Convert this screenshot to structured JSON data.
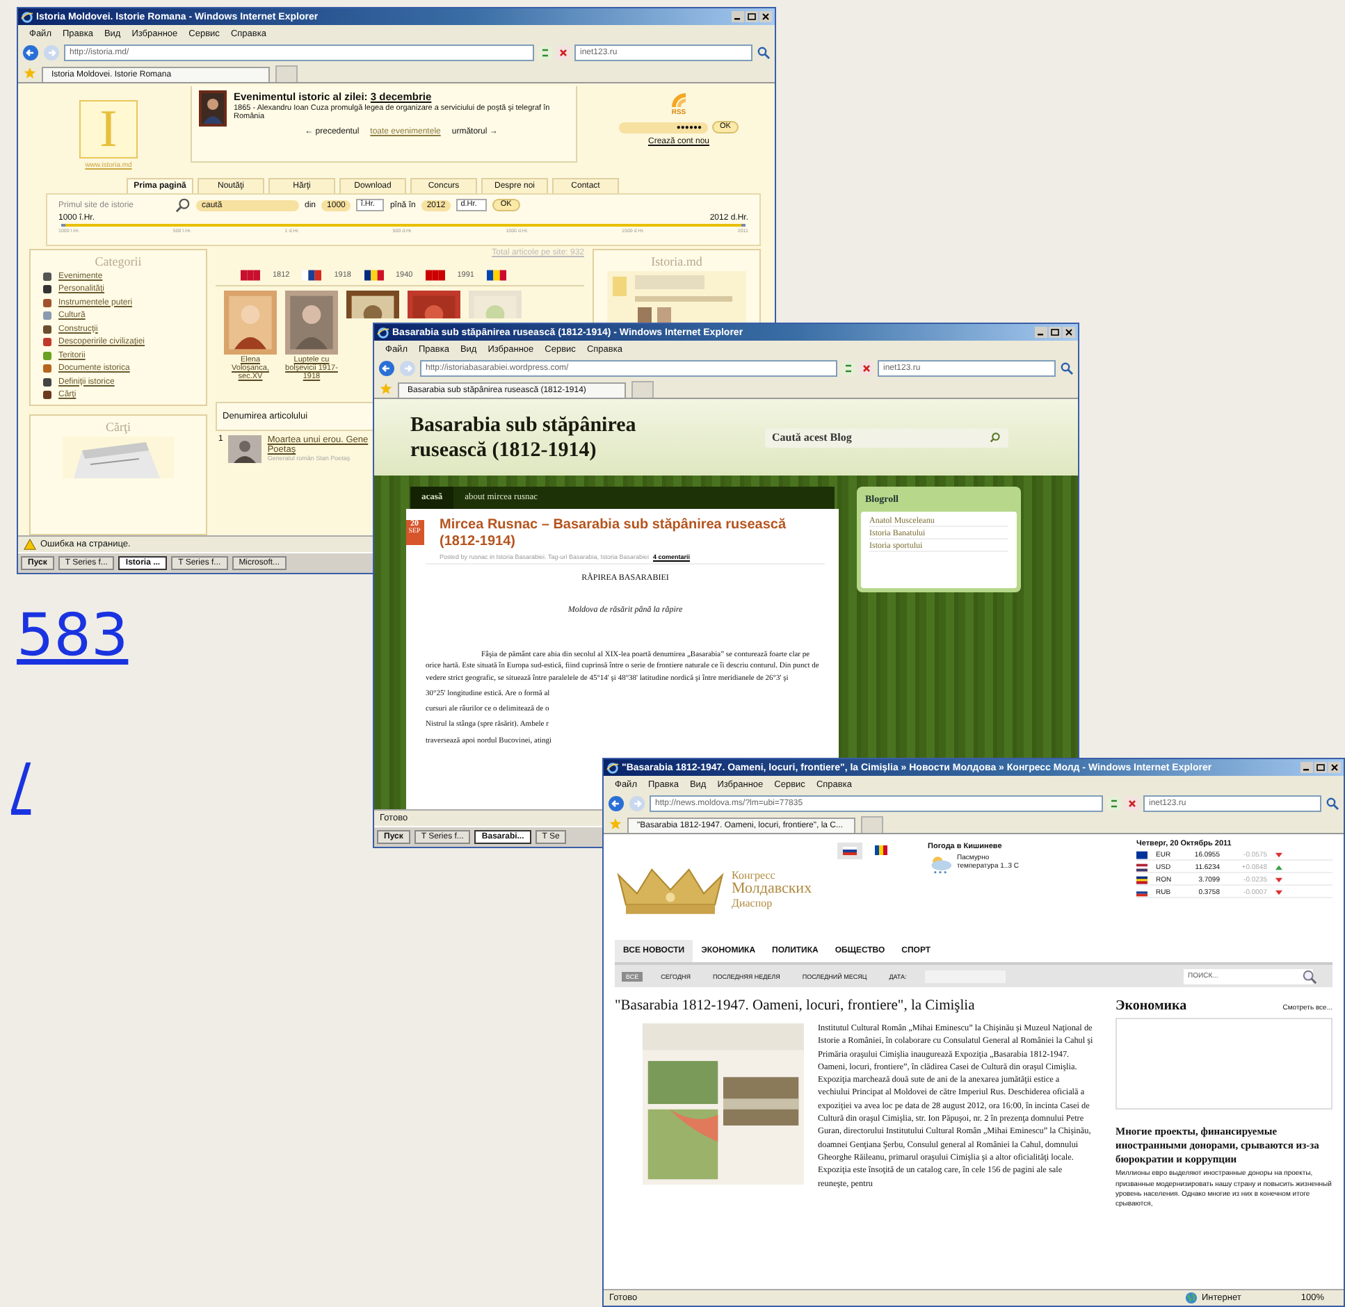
{
  "background_links": [
    "583",
    "/"
  ],
  "windows": [
    {
      "kind": "istoria",
      "title": "Istoria Moldovei. Istorie Romana - Windows Internet Explorer",
      "menu": [
        "Файл",
        "Правка",
        "Вид",
        "Избранное",
        "Сервис",
        "Справка"
      ],
      "address": "http://istoria.md/",
      "search": "inet123.ru",
      "tab": "Istoria Moldovei. Istorie Romana",
      "status": "Ошибка на странице.",
      "status_warning": true,
      "taskbar": [
        {
          "kind": "start",
          "label": "Пуск",
          "selected": false
        },
        {
          "kind": "app",
          "label": "T Series f...",
          "selected": false
        },
        {
          "kind": "ie",
          "label": "Istoria ...",
          "selected": true
        },
        {
          "kind": "app",
          "label": "T Series f...",
          "selected": false
        },
        {
          "kind": "doc",
          "label": "Microsoft...",
          "selected": false
        }
      ]
    },
    {
      "kind": "blog",
      "title": "Basarabia sub stăpânirea rusească (1812-1914) - Windows Internet Explorer",
      "menu": [
        "Файл",
        "Правка",
        "Вид",
        "Избранное",
        "Сервис",
        "Справка"
      ],
      "address": "http://istoriabasarabiei.wordpress.com/",
      "search": "inet123.ru",
      "tab": "Basarabia sub stăpânirea rusească (1812-1914)",
      "status": "Готово",
      "status_warning": false,
      "taskbar": [
        {
          "kind": "start",
          "label": "Пуск",
          "selected": false
        },
        {
          "kind": "app",
          "label": "T Series f...",
          "selected": false
        },
        {
          "kind": "ie",
          "label": "Basarabi...",
          "selected": true
        },
        {
          "kind": "app",
          "label": "T Se",
          "selected": false
        }
      ]
    },
    {
      "kind": "news",
      "title": "\"Basarabia 1812-1947. Oameni, locuri, frontiere\", la Cimişlia » Новости Молдова » Конгресс Молд - Windows Internet Explorer",
      "menu": [
        "Файл",
        "Правка",
        "Вид",
        "Избранное",
        "Сервис",
        "Справка"
      ],
      "address": "http://news.moldova.ms/?lm=ubi=77835",
      "search": "inet123.ru",
      "tab": "\"Basarabia 1812-1947. Oameni, locuri, frontiere\", la C...",
      "status": "Готово",
      "status_warning": false,
      "zone": "Интернет",
      "zoom": "100%"
    }
  ],
  "istoria": {
    "logo_letter": "I",
    "logo_caption": "www.istoria.md",
    "event": {
      "heading": "Evenimentul istoric al zilei:",
      "date": "3 decembrie",
      "text": "1865 - Alexandru Ioan Cuza promulgă legea de organizare a serviciului de poştă şi telegraf în România",
      "prev": "← precedentul",
      "all": "toate evenimentele",
      "next": "următorul →"
    },
    "rss": "RSS",
    "password": "●●●●●●",
    "login_button": "OK",
    "register_link": "Crează cont nou",
    "tabs": [
      {
        "label": "Prima pagină",
        "selected": true
      },
      {
        "label": "Noutăţi",
        "selected": false
      },
      {
        "label": "Hărţi",
        "selected": false
      },
      {
        "label": "Download",
        "selected": false
      },
      {
        "label": "Concurs",
        "selected": false
      },
      {
        "label": "Despre noi",
        "selected": false
      },
      {
        "label": "Contact",
        "selected": false
      }
    ],
    "search": {
      "tagline": "Primul site de istorie",
      "query": "caută",
      "from_label": "din",
      "from_year": "1000",
      "from_era": "î.Hr.",
      "to_label": "pînă în",
      "to_year": "2012",
      "to_era": "d.Hr.",
      "button": "OK"
    },
    "timeline": {
      "start": "1000 î.Hr.",
      "end": "2012 d.Hr.",
      "level": 1,
      "ticks": [
        "1000 î.Hr.",
        "500 î.Hr.",
        "1 d.Hr.",
        "500 d.Hr.",
        "1000 d.Hr.",
        "1500 d.Hr.",
        "2011"
      ]
    },
    "total": "Total articole pe site: 932",
    "categories_title": "Categorii",
    "categories": [
      "Evenimente",
      "Personalităţi",
      "Instrumentele puteri",
      "Cultură",
      "Construcţii",
      "Descoperirile civilizaţiei",
      "Teritorii",
      "Documente istorica",
      "Definiţii istorice",
      "Cărţi"
    ],
    "books_title": "Cărţi",
    "years": [
      "1812",
      "1918",
      "1940",
      "1991"
    ],
    "gallery": [
      {
        "kind": "full",
        "caption": "Elena Voloşanca, sec.XV"
      },
      {
        "kind": "full",
        "caption": "Luptele cu bolşevicii 1917-1918"
      },
      {
        "kind": "cropped"
      },
      {
        "kind": "cropped"
      },
      {
        "kind": "cropped"
      }
    ],
    "articles_header": "Denumirea articolului",
    "articles": [
      {
        "number": "1",
        "title": "Moartea unui erou. Gene",
        "title_cont": "Poetaş",
        "summary": "Generalul român Stan Poetaş"
      }
    ],
    "side_title": "Istoria.md"
  },
  "blog": {
    "title": "Basarabia sub stăpânirea rusească (1812-1914)",
    "search_placeholder": "Caută acest Blog",
    "nav": [
      {
        "label": "acasă",
        "selected": true
      },
      {
        "label": "about mircea rusnac",
        "selected": false
      }
    ],
    "day": "20",
    "month": "SEP",
    "post_title": "Mircea Rusnac – Basarabia sub stăpânirea rusească (1812-1914)",
    "meta": "Posted by rusnac in Istoria Basarabiei. Tag-uri Basarabia, Istoria Basarabiei",
    "comments": "4 comentarii",
    "heading": "RĂPIREA BASARABIEI",
    "subheading": "Moldova de răsărit până la răpire",
    "paragraph": "Fâşia de pământ care abia din secolul al XIX-lea poartă denumirea „Basarabia” se conturează foarte clar pe orice hartă. Este situată în Europa sud-estică, fiind cuprinsă între o serie de frontiere naturale ce îi descriu conturul. Din punct de vedere strict geografic, se situează între paralelele de 45°14' şi 48°38' latitudine nordică şi între meridianele de 26°3' şi",
    "paragraph_lines": [
      "30°25' longitudine estică. Are o formă al",
      "cursuri ale râurilor ce o delimitează de o",
      "Nistrul la stânga (spre răsărit). Ambele r",
      "traversează apoi nordul Bucovinei, atingi"
    ],
    "blogroll_title": "Blogroll",
    "blogroll": [
      "Anatol Musceleanu",
      "Istoria Banatului",
      "Istoria sportului"
    ]
  },
  "news": {
    "languages": [
      {
        "kind": "ru",
        "selected": true
      },
      {
        "kind": "md",
        "selected": false
      }
    ],
    "logo_lines": [
      "Конгресс",
      "Молдавских",
      "Диаспор"
    ],
    "weather_title": "Погода в Кишиневе",
    "weather_state": "Пасмурно",
    "weather_temp": "температура 1..3 C",
    "date": "Четверг, 20 Октябрь 2011",
    "rates": [
      {
        "currency": "EUR",
        "rate": "16.0955",
        "change": "-0.0575",
        "rising": false
      },
      {
        "currency": "USD",
        "rate": "11.6234",
        "change": "+0.0848",
        "rising": true
      },
      {
        "currency": "RON",
        "rate": "3.7099",
        "change": "-0.0235",
        "rising": false
      },
      {
        "currency": "RUB",
        "rate": "0.3758",
        "change": "-0.0007",
        "rising": false
      }
    ],
    "tabs": [
      {
        "label": "ВСЕ НОВОСТИ",
        "selected": true
      },
      {
        "label": "ЭКОНОМИКА",
        "selected": false
      },
      {
        "label": "ПОЛИТИКА",
        "selected": false
      },
      {
        "label": "ОБЩЕСТВО",
        "selected": false
      },
      {
        "label": "СПОРТ",
        "selected": false
      }
    ],
    "filters": [
      {
        "label": "ВСЕ",
        "selected": true
      },
      {
        "label": "СЕГОДНЯ",
        "selected": false
      },
      {
        "label": "ПОСЛЕДНЯЯ НЕДЕЛЯ",
        "selected": false
      },
      {
        "label": "ПОСЛЕДНИЙ МЕСЯЦ",
        "selected": false
      }
    ],
    "date_label": "ДАТА:",
    "search_placeholder": "ПОИСК...",
    "headline": "\"Basarabia 1812-1947. Oameni, locuri, frontiere\", la Cimişlia",
    "article": "Institutul Cultural Român „Mihai Eminescu” la Chişinău şi Muzeul Naţional de Istorie a României, în colaborare cu Consulatul General al României la Cahul şi Primăria oraşului Cimişlia inaugurează Expoziţia „Basarabia 1812-1947. Oameni, locuri, frontiere”, în clădirea Casei de Cultură din oraşul Cimişlia. Expoziţia marchează două sute de ani de la anexarea jumătăţii estice a vechiului Principat al Moldovei de către Imperiul Rus. Deschiderea oficială a expoziţiei va avea loc pe data de 28 august 2012, ora 16:00, în incinta Casei de Cultură din oraşul Cimişlia, str. Ion Păpuşoi, nr. 2 în prezenţa domnului Petre Guran, directorului Institutului Cultural Român „Mihai Eminescu” la Chişinău, doamnei Genţiana Şerbu, Consulul general al României la Cahul, domnului Gheorghe Răileanu, primarul oraşului Cimişlia şi a altor oficialităţi locale. Expoziţia este însoţită de un catalog care, în cele 156 de pagini ale sale reuneşte, pentru",
    "side_title": "Экономика",
    "side_link": "Смотреть все...",
    "side_headline": "Многие проекты, финансируемые иностранными донорами, срываются из-за бюрократии и коррупции",
    "side_text": "Миллионы евро выделяют иностранные доноры на проекты, призванные модернизировать нашу страну и повысить жизненный уровень населения. Однако многие из них в конечном итоге срываются,"
  }
}
